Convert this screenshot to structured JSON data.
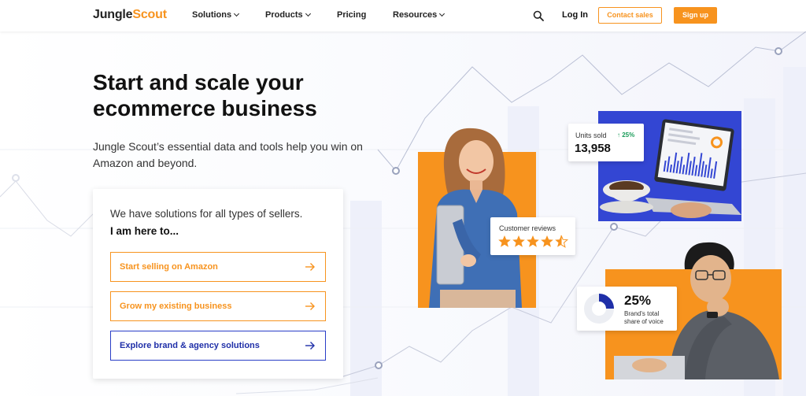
{
  "nav": {
    "logo_part1": "Jungle",
    "logo_part2": "Scout",
    "items": [
      "Solutions",
      "Products",
      "Pricing",
      "Resources"
    ],
    "login": "Log In",
    "contact": "Contact sales",
    "signup": "Sign up"
  },
  "hero": {
    "headline_line1": "Start and scale your",
    "headline_line2": "ecommerce business",
    "subtext": "Jungle Scout’s essential data and tools help you win on Amazon and beyond."
  },
  "card": {
    "title": "We have solutions for all types of sellers.",
    "subtitle": "I am here to...",
    "options": [
      "Start selling on Amazon",
      "Grow my existing business",
      "Explore brand & agency solutions"
    ]
  },
  "stats": {
    "units_label": "Units sold",
    "units_change": "↑ 25%",
    "units_value": "13,958",
    "reviews_label": "Customer reviews",
    "reviews_rating": 4.5,
    "share_value": "25%",
    "share_label_line1": "Brand's total",
    "share_label_line2": "share of voice"
  },
  "colors": {
    "brand_orange": "#f7931e",
    "brand_blue": "#2a3ec7",
    "change_green": "#1a9c5a"
  }
}
